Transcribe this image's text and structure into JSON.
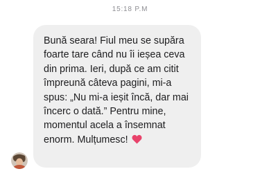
{
  "timestamp": "15:18 P.M",
  "message": {
    "text": "Bună seara! Fiul meu se supăra foarte tare când nu îi ieșea ceva din prima. Ieri, după ce am citit împreună câteva pagini, mi-a spus: „Nu mi-a ieșit încă, dar mai încerc o dată.” Pentru mine, momentul acela a însemnat enorm. Mulțumesc!",
    "emoji": "heart-icon",
    "bubble_color": "#efefef",
    "text_color": "#1c1c1e"
  },
  "avatar": {
    "icon": "user-avatar"
  }
}
